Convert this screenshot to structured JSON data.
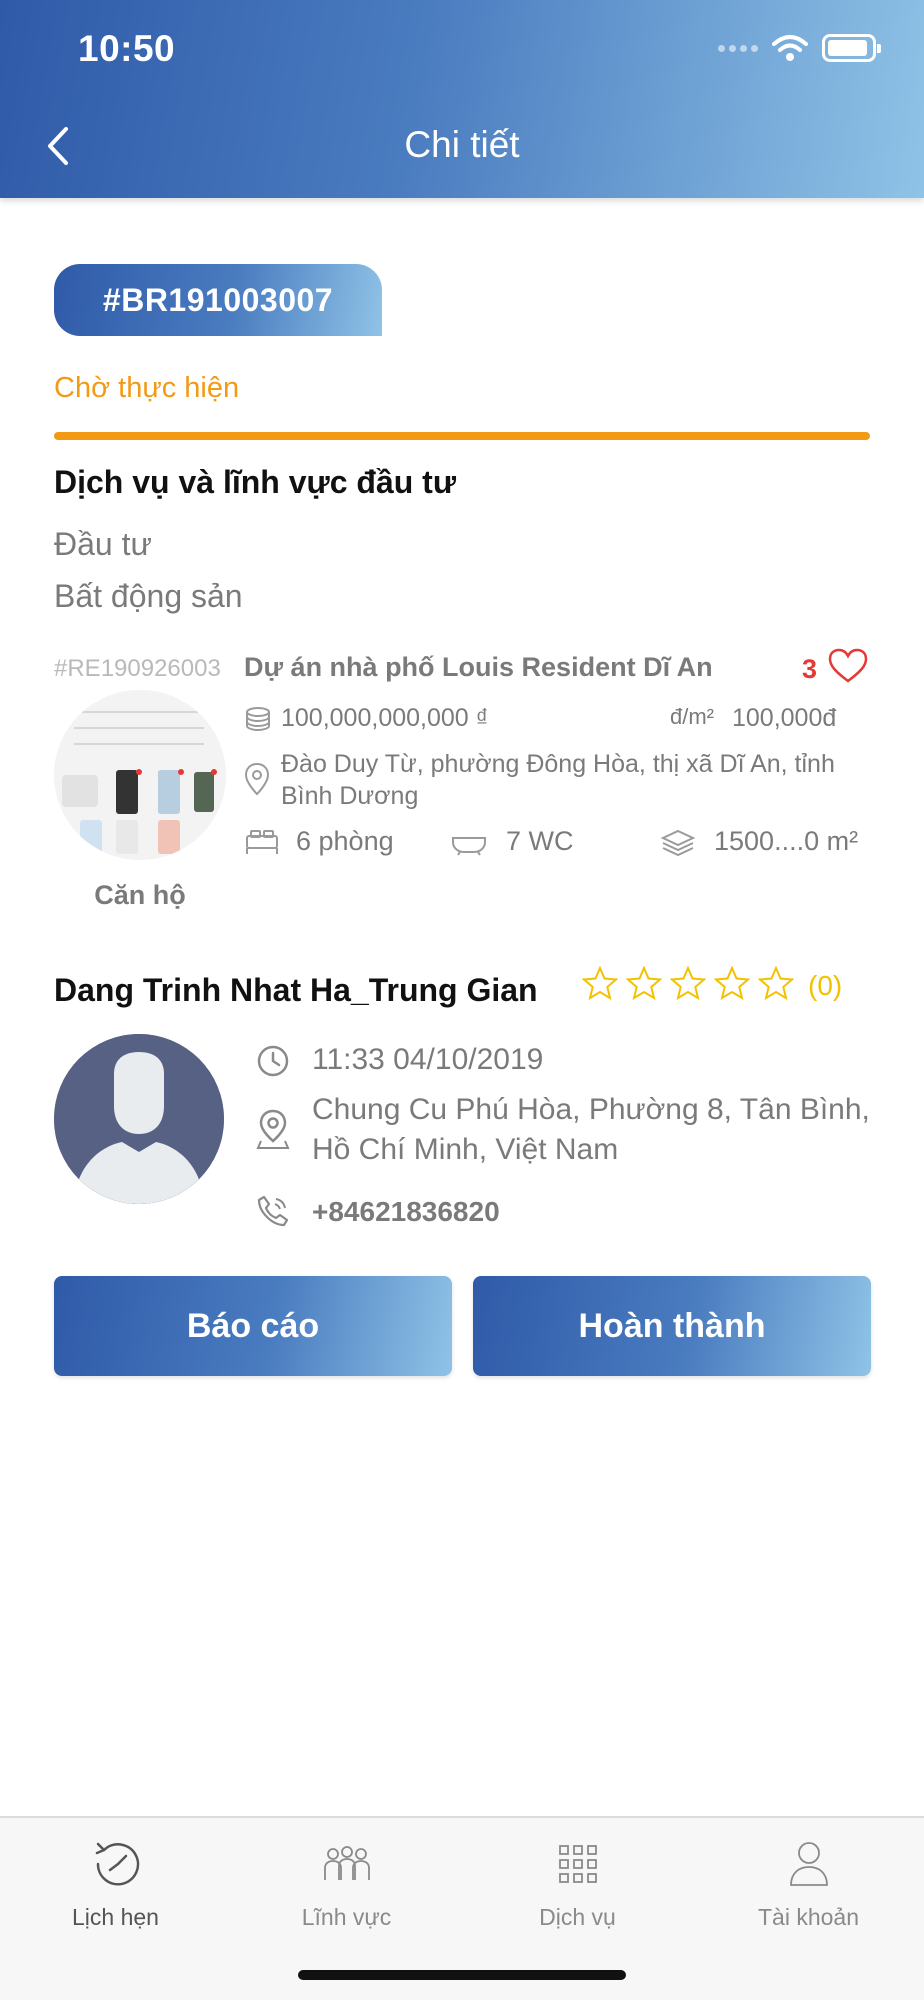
{
  "status_bar": {
    "time": "10:50"
  },
  "header": {
    "title": "Chi tiết"
  },
  "booking": {
    "code": "#BR191003007",
    "status": "Chờ thực hiện",
    "status_color": "#f39a14"
  },
  "service": {
    "section_title": "Dịch vụ và lĩnh vực đầu tư",
    "lines": [
      "Đầu tư",
      "Bất động sản"
    ]
  },
  "property": {
    "code": "#RE190926003",
    "title": "Dự án nhà phố Louis Resident Dĩ An",
    "likes": "3",
    "price": "100,000,000,000 ₫",
    "unit_label": "đ/m²",
    "unit_price": "100,000đ",
    "address_line1": "Đào Duy Từ, phường Đông Hòa, thị xã Dĩ An, tỉnh",
    "address_line2": "Bình Dương",
    "rooms": "6 phòng",
    "wc": "7 WC",
    "area": "1500....0 m²",
    "type": "Căn hộ"
  },
  "agent": {
    "name": "Dang Trinh Nhat Ha_Trung Gian",
    "rating_count": "(0)",
    "rating": 0,
    "datetime": "11:33 04/10/2019",
    "address_line1": "Chung Cu Phú Hòa, Phường 8, Tân Bình,",
    "address_line2": "Hồ Chí Minh, Việt Nam",
    "phone": "+84621836820"
  },
  "actions": {
    "report": "Báo cáo",
    "complete": "Hoàn thành"
  },
  "tabbar": {
    "tabs": [
      {
        "label": "Lịch hẹn",
        "icon": "clock-history-icon"
      },
      {
        "label": "Lĩnh vực",
        "icon": "people-group-icon"
      },
      {
        "label": "Dịch vụ",
        "icon": "grid-icon"
      },
      {
        "label": "Tài khoản",
        "icon": "user-icon"
      }
    ]
  },
  "colors": {
    "accent_start": "#2f5aa8",
    "accent_end": "#8fc3e6",
    "orange": "#f39a14",
    "star": "#f2c200",
    "like": "#e53935"
  }
}
